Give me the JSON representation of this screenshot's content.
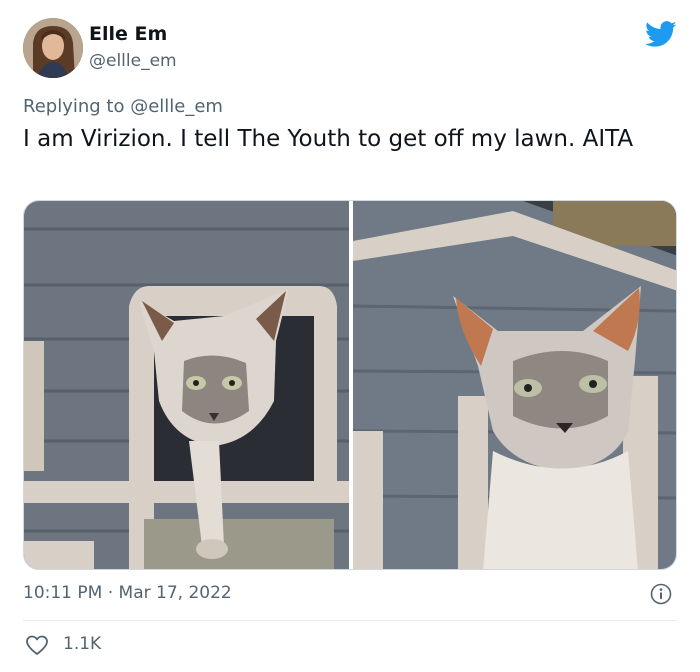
{
  "author": {
    "display_name": "Elle Em",
    "handle": "@ellle_em"
  },
  "reply": {
    "prefix": "Replying to ",
    "to": "@ellle_em"
  },
  "tweet": {
    "text": "I am Virizion. I tell The Youth to get off my lawn. AITA"
  },
  "media": {
    "photos": [
      {
        "icon": "cat-photo-left"
      },
      {
        "icon": "cat-photo-right"
      }
    ]
  },
  "meta": {
    "timestamp": "10:11 PM · Mar 17, 2022"
  },
  "engagement": {
    "likes": "1.1K"
  },
  "colors": {
    "brand_blue": "#1d9bf0",
    "secondary_text": "#536471",
    "primary_text": "#0f1419"
  }
}
